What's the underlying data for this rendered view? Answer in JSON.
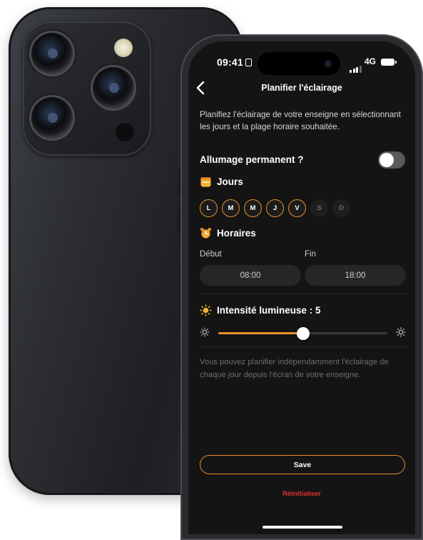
{
  "status_bar": {
    "time": "09:41",
    "network": "4G"
  },
  "nav": {
    "title": "Planifier l'éclairage"
  },
  "intro": "Planifiez l'éclairage de votre enseigne en sélectionnant les jours et la plage horaire souhaitée.",
  "permanent": {
    "label": "Allumage permanent ?",
    "enabled": false
  },
  "days": {
    "label": "Jours",
    "items": [
      {
        "label": "L",
        "selected": true
      },
      {
        "label": "M",
        "selected": true
      },
      {
        "label": "M",
        "selected": true
      },
      {
        "label": "J",
        "selected": true
      },
      {
        "label": "V",
        "selected": true
      },
      {
        "label": "S",
        "selected": false
      },
      {
        "label": "D",
        "selected": false
      }
    ]
  },
  "hours": {
    "label": "Horaires",
    "start_label": "Début",
    "end_label": "Fin",
    "start": "08:00",
    "end": "18:00"
  },
  "intensity": {
    "label": "Intensité lumineuse : 5",
    "value": 5,
    "min": 0,
    "max": 10
  },
  "note": "Vous pouvez planifier indépendamment l'éclairage de chaque jour depuis l'écran de votre enseigne.",
  "actions": {
    "save": "Save",
    "reset": "Réinitialiser"
  },
  "colors": {
    "accent": "#e8902a",
    "danger": "#e0332a",
    "background": "#141414"
  },
  "icons": {
    "back": "chevron-left-icon",
    "days": "calendar-icon",
    "hours": "alarm-clock-icon",
    "intensity": "sun-icon"
  }
}
